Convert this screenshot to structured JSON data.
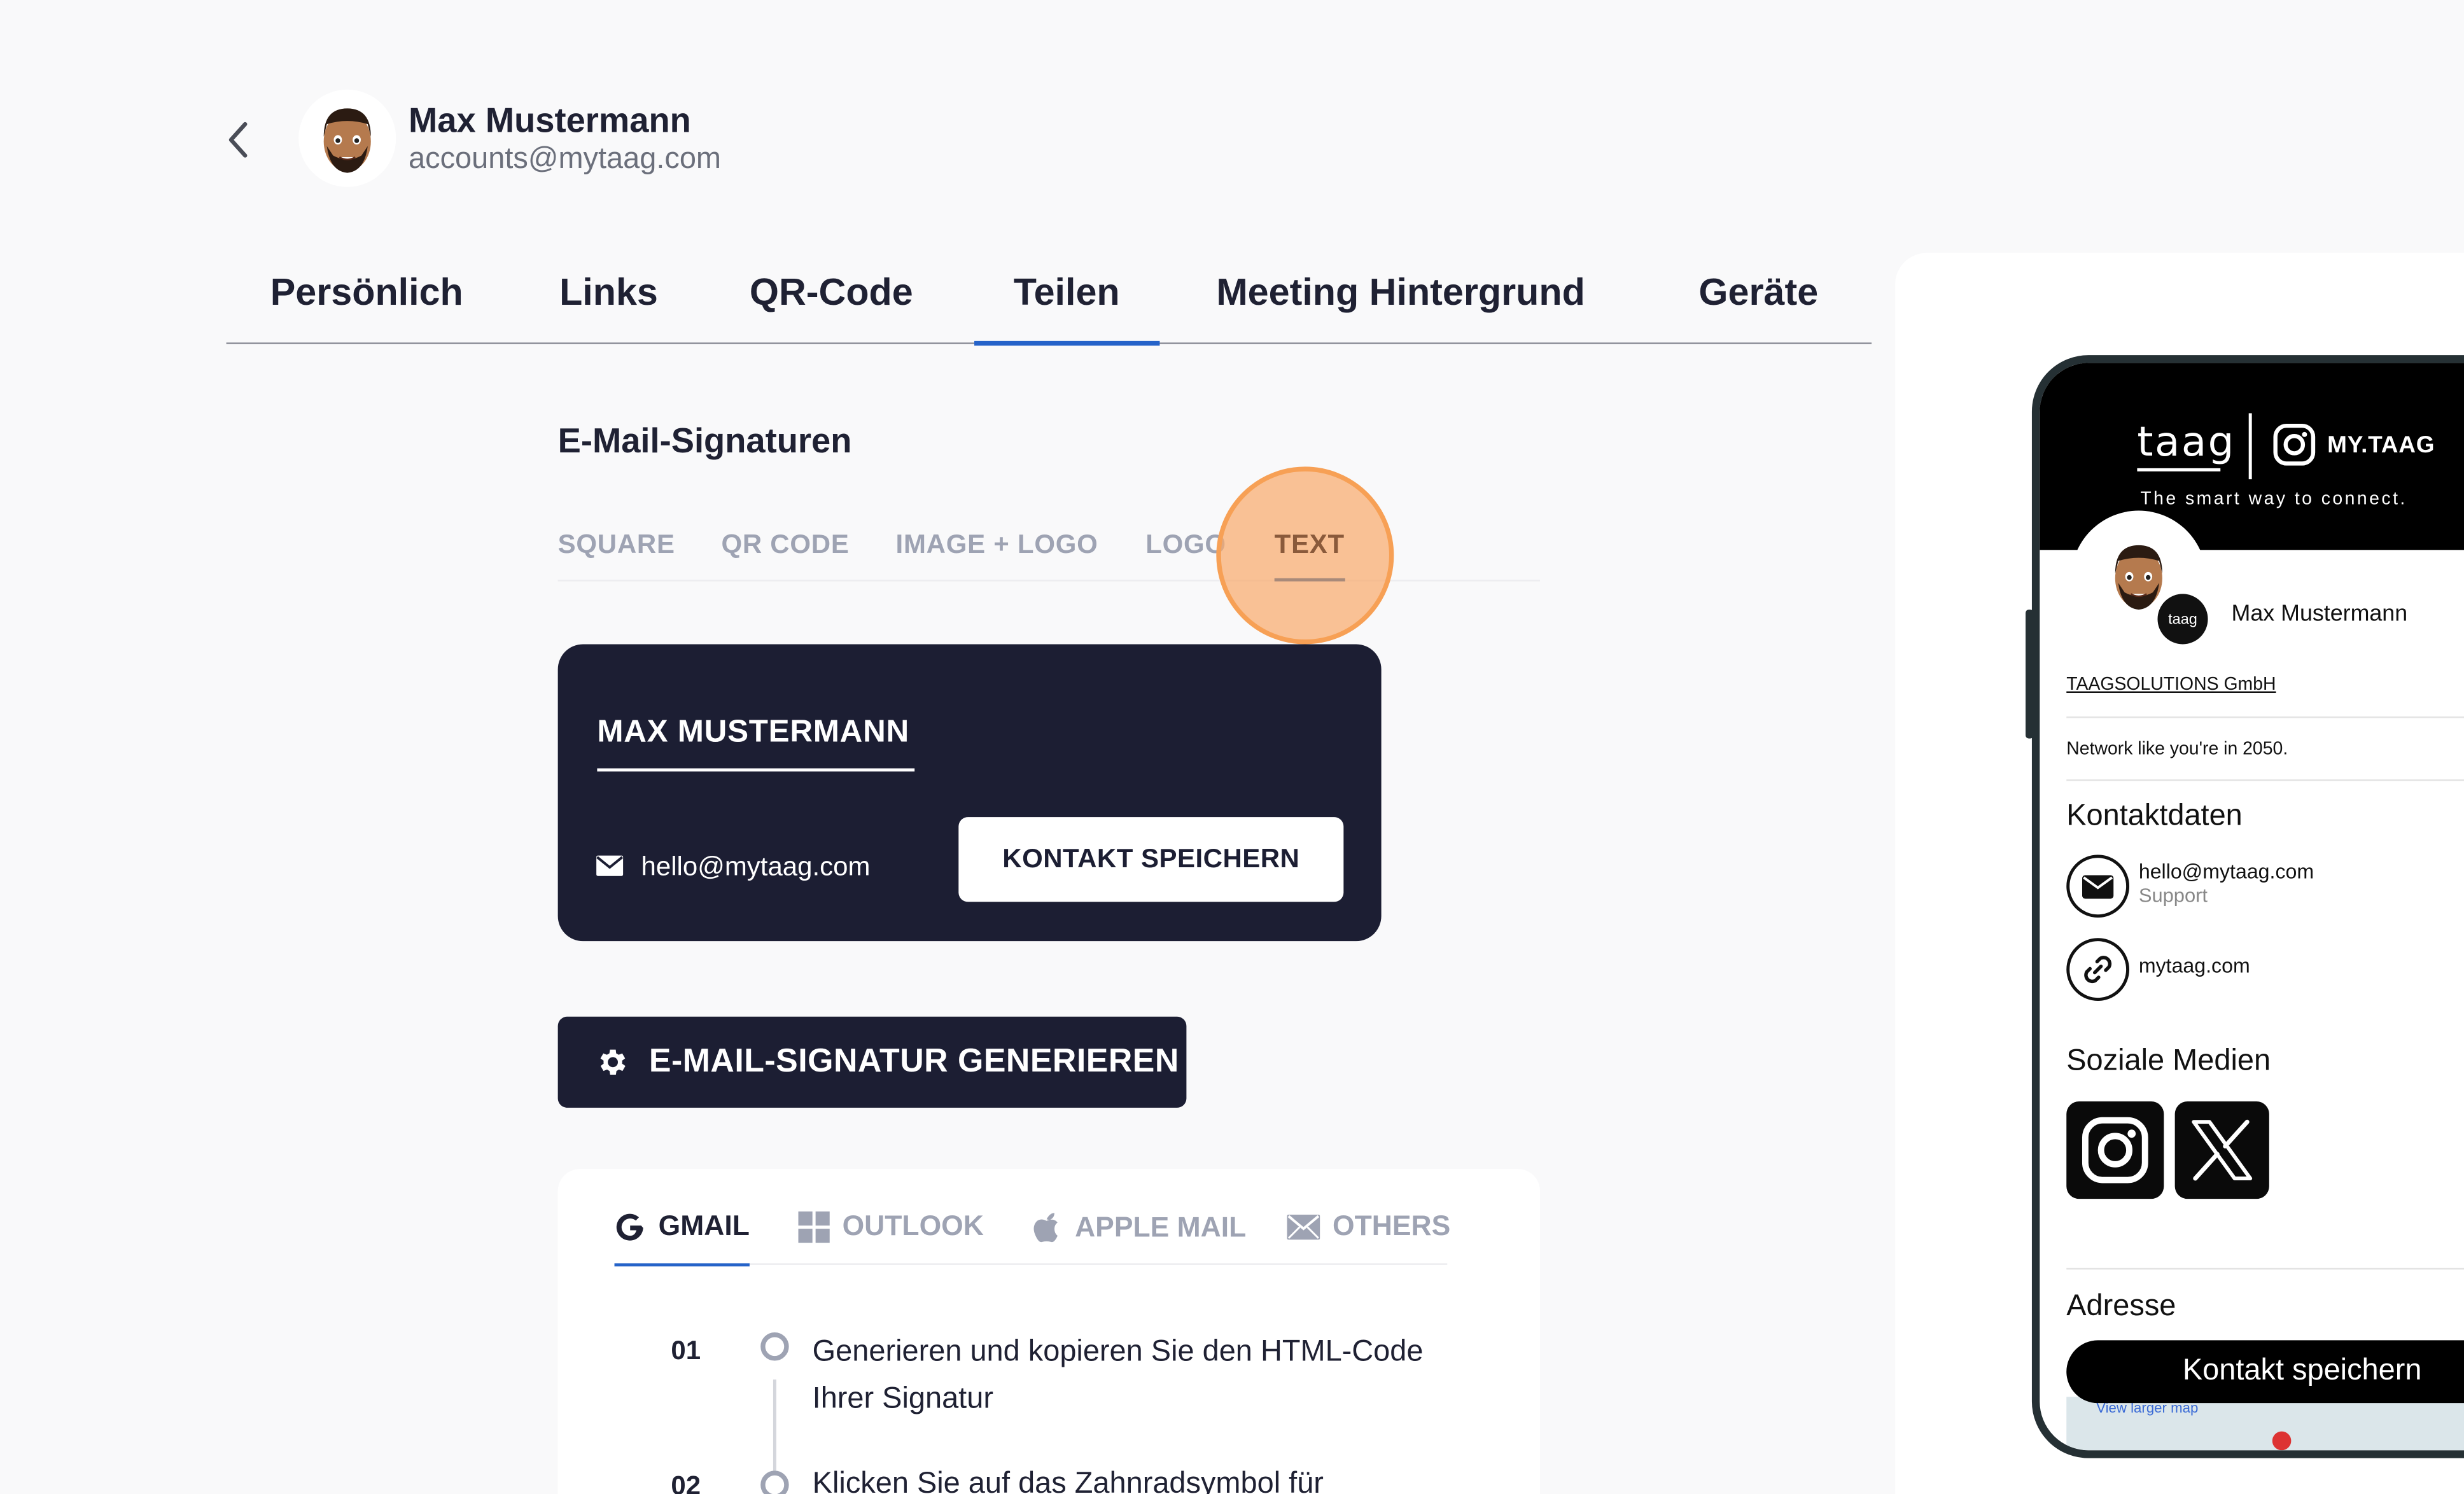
{
  "user": {
    "name": "Max Mustermann",
    "email": "accounts@mytaag.com"
  },
  "tabs": [
    {
      "label": "Persönlich"
    },
    {
      "label": "Links"
    },
    {
      "label": "QR-Code"
    },
    {
      "label": "Teilen",
      "active": true
    },
    {
      "label": "Meeting Hintergrund"
    },
    {
      "label": "Geräte"
    }
  ],
  "section": {
    "title": "E-Mail-Signaturen"
  },
  "signature_tabs": [
    {
      "label": "SQUARE"
    },
    {
      "label": "QR CODE"
    },
    {
      "label": "IMAGE + LOGO"
    },
    {
      "label": "LOGO"
    },
    {
      "label": "TEXT",
      "active": true
    }
  ],
  "preview": {
    "name": "MAX MUSTERMANN",
    "email": "hello@mytaag.com",
    "button": "KONTAKT SPEICHERN"
  },
  "generate_button": "E-MAIL-SIGNATUR GENERIEREN",
  "clients": [
    {
      "label": "GMAIL",
      "icon": "google-icon",
      "active": true
    },
    {
      "label": "OUTLOOK",
      "icon": "windows-icon"
    },
    {
      "label": "APPLE MAIL",
      "icon": "apple-icon"
    },
    {
      "label": "OTHERS",
      "icon": "envelope-icon"
    }
  ],
  "steps": [
    {
      "number": "01",
      "text": "Generieren und kopieren Sie den HTML-Code Ihrer Signatur"
    },
    {
      "number": "02",
      "text": "Klicken Sie auf das Zahnradsymbol für"
    }
  ],
  "phone": {
    "logo": "taag",
    "brand": "MY.TAAG",
    "slogan": "The smart way to connect.",
    "badge": "taag",
    "name": "Max Mustermann",
    "company": "TAAGSOLUTIONS GmbH",
    "tagline": "Network like you're in 2050.",
    "contacts_heading": "Kontaktdaten",
    "contact_email": "hello@mytaag.com",
    "contact_email_label": "Support",
    "contact_url": "mytaag.com",
    "social_heading": "Soziale Medien",
    "address_heading": "Adresse",
    "save_button": "Kontakt speichern",
    "map_link": "View larger map"
  },
  "colors": {
    "navy": "#1c1e33",
    "accent_blue": "#2563c9",
    "highlight_orange": "#f7a055",
    "background": "#f9f9fa"
  }
}
